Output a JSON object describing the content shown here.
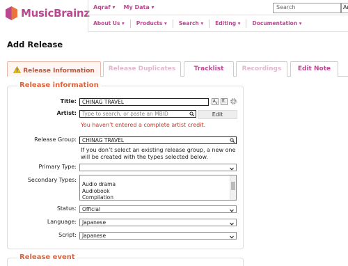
{
  "header": {
    "logo_text": "MusicBrainz",
    "user_menu": "Aqraf ▾",
    "mydata_menu": "My Data ▾",
    "search_placeholder": "Search",
    "search_type": "Artist",
    "nav": [
      "About Us ▾",
      "Products ▾",
      "Search ▾",
      "Editing ▾",
      "Documentation ▾"
    ]
  },
  "page_title": "Add Release",
  "tabs": [
    {
      "label": "Release Information",
      "state": "active"
    },
    {
      "label": "Release Duplicates",
      "state": "disabled"
    },
    {
      "label": "Tracklist",
      "state": "normal"
    },
    {
      "label": "Recordings",
      "state": "disabled"
    },
    {
      "label": "Edit Note",
      "state": "normal"
    }
  ],
  "release_info": {
    "legend": "Release information",
    "title_label": "Title:",
    "title_value": "CHINAG TRAVEL",
    "artist_label": "Artist:",
    "artist_placeholder": "Type to search, or paste an MBID",
    "edit_button": "Edit",
    "artist_error": "You haven’t entered a complete artist credit.",
    "release_group_label": "Release Group:",
    "release_group_value": "CHINAG TRAVEL",
    "release_group_help": "If you don’t select an existing release group, a new one will be created with the types selected below.",
    "primary_type_label": "Primary Type:",
    "primary_type_value": "",
    "secondary_types_label": "Secondary Types:",
    "secondary_types_options": [
      "Audio drama",
      "Audiobook",
      "Compilation"
    ],
    "status_label": "Status:",
    "status_value": "Official",
    "language_label": "Language:",
    "language_value": "Japanese",
    "script_label": "Script:",
    "script_value": "Japanese"
  },
  "release_event": {
    "legend": "Release event"
  },
  "colors": {
    "brand": "#ba478f",
    "legend": "#e0623a",
    "error": "#c0392b",
    "active_tab": "#c0573a",
    "logo_orange": "#eb743b",
    "logo_purple": "#ba478f"
  },
  "icons": {
    "logo": "musicbrainz-logo-icon",
    "warning": "warning-icon",
    "search": "magnifier-icon",
    "guess_case": "guess-case-icon",
    "gear": "gear-icon"
  }
}
